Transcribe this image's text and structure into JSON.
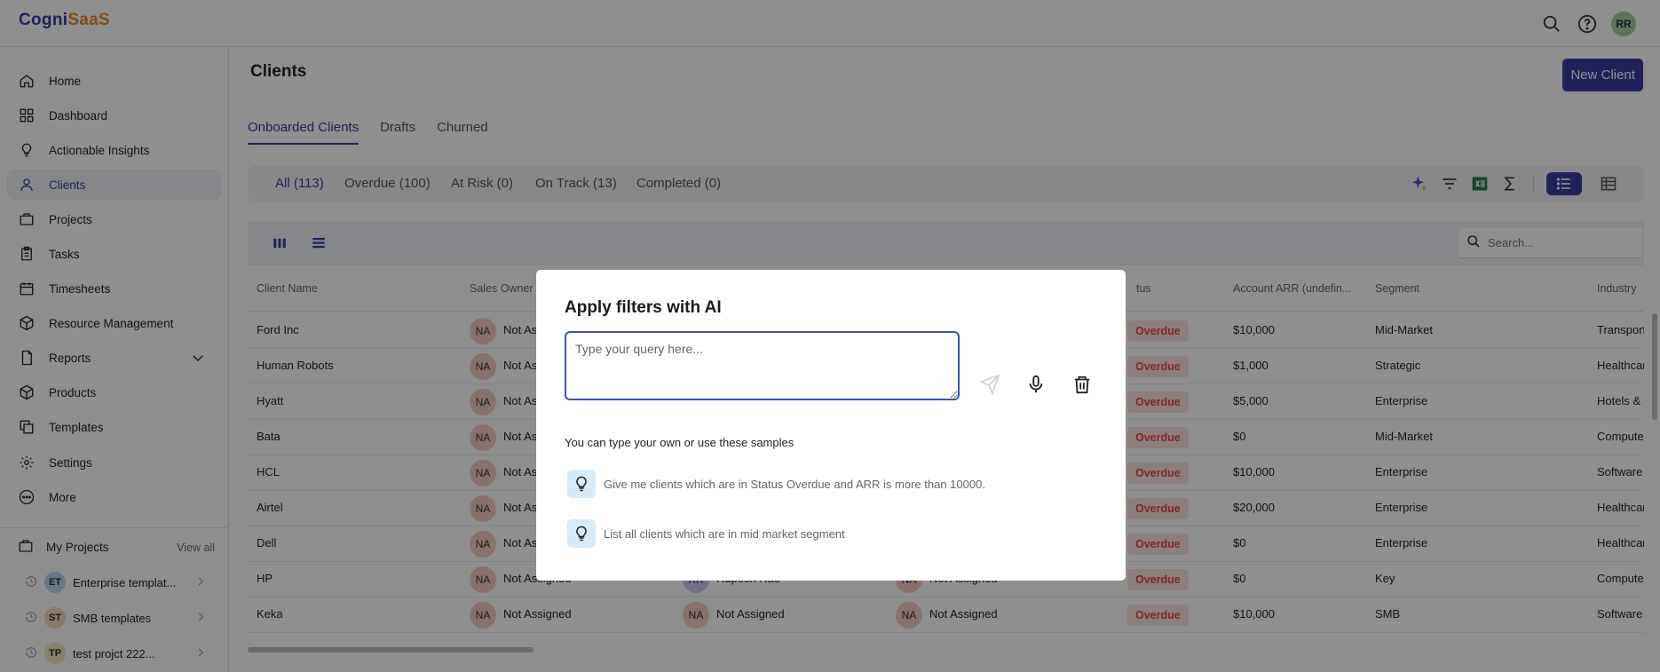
{
  "app": {
    "logo_part1": "Cogni",
    "logo_part2": "SaaS",
    "user_initials": "RR"
  },
  "sidebar": {
    "items": [
      {
        "label": "Home",
        "icon": "home-icon"
      },
      {
        "label": "Dashboard",
        "icon": "dashboard-icon"
      },
      {
        "label": "Actionable Insights",
        "icon": "bulb-icon"
      },
      {
        "label": "Clients",
        "icon": "user-icon"
      },
      {
        "label": "Projects",
        "icon": "briefcase-icon"
      },
      {
        "label": "Tasks",
        "icon": "clipboard-icon"
      },
      {
        "label": "Timesheets",
        "icon": "calendar-icon"
      },
      {
        "label": "Resource Management",
        "icon": "cube-icon"
      },
      {
        "label": "Reports",
        "icon": "file-icon"
      },
      {
        "label": "Products",
        "icon": "box-icon"
      },
      {
        "label": "Templates",
        "icon": "copy-icon"
      },
      {
        "label": "Settings",
        "icon": "gear-icon"
      },
      {
        "label": "More",
        "icon": "more-icon"
      }
    ],
    "my_projects_label": "My Projects",
    "view_all": "View all",
    "projects": [
      {
        "initials": "ET",
        "name": "Enterprise templat...",
        "color": "#bcd3ee"
      },
      {
        "initials": "ST",
        "name": "SMB templates",
        "color": "#f1d7b8"
      },
      {
        "initials": "TP",
        "name": "test projct 222...",
        "color": "#f1e7b8"
      }
    ]
  },
  "page": {
    "title": "Clients",
    "new_client": "New Client",
    "tabs": [
      "Onboarded Clients",
      "Drafts",
      "Churned"
    ],
    "filters": [
      "All (113)",
      "Overdue (100)",
      "At Risk (0)",
      "On Track (13)",
      "Completed (0)"
    ],
    "search_placeholder": "Search..."
  },
  "table": {
    "columns": [
      "Client Name",
      "Sales Owner",
      "tus",
      "Account ARR (undefin...",
      "Segment",
      "Industry"
    ],
    "rows": [
      {
        "name": "Ford Inc",
        "owner": "Not Assigned",
        "status": "Overdue",
        "arr": "$10,000",
        "segment": "Mid-Market",
        "industry": "Transportati..."
      },
      {
        "name": "Human Robots",
        "owner": "Not Assigned",
        "status": "Overdue",
        "arr": "$1,000",
        "segment": "Strategic",
        "industry": "Healthcare S"
      },
      {
        "name": "Hyatt",
        "owner": "Not Assigned",
        "status": "Overdue",
        "arr": "$5,000",
        "segment": "Enterprise",
        "industry": "Hotels & Mo"
      },
      {
        "name": "Bata",
        "owner": "Not Assigned",
        "status": "Overdue",
        "arr": "$0",
        "segment": "Mid-Market",
        "industry": "Computer an"
      },
      {
        "name": "HCL",
        "owner": "Not Assigned",
        "status": "Overdue",
        "arr": "$10,000",
        "segment": "Enterprise",
        "industry": "Software an"
      },
      {
        "name": "Airtel",
        "owner": "Not Assigned",
        "status": "Overdue",
        "arr": "$20,000",
        "segment": "Enterprise",
        "industry": "Healthcare S"
      },
      {
        "name": "Dell",
        "owner": "Not Assigned",
        "status": "Overdue",
        "arr": "$0",
        "segment": "Enterprise",
        "industry": "Healthcare S"
      },
      {
        "name": "HP",
        "owner": "Not Assigned",
        "owner2_initials": "RR",
        "owner2": "Rupesh Rao",
        "owner3": "Not Assigned",
        "status": "Overdue",
        "arr": "$0",
        "segment": "Key",
        "industry": "Computer H"
      },
      {
        "name": "Keka",
        "owner": "Not Assigned",
        "owner2_initials": "NA",
        "owner2": "Not Assigned",
        "owner3": "Not Assigned",
        "status": "Overdue",
        "arr": "$10,000",
        "segment": "SMB",
        "industry": "Software an"
      }
    ],
    "na": "NA"
  },
  "modal": {
    "title": "Apply filters with AI",
    "placeholder": "Type your query here...",
    "samples_title": "You can type your own or use these samples",
    "samples": [
      "Give me clients which are in Status Overdue and ARR is more than 10000.",
      "List all clients which are in mid market segment"
    ]
  }
}
